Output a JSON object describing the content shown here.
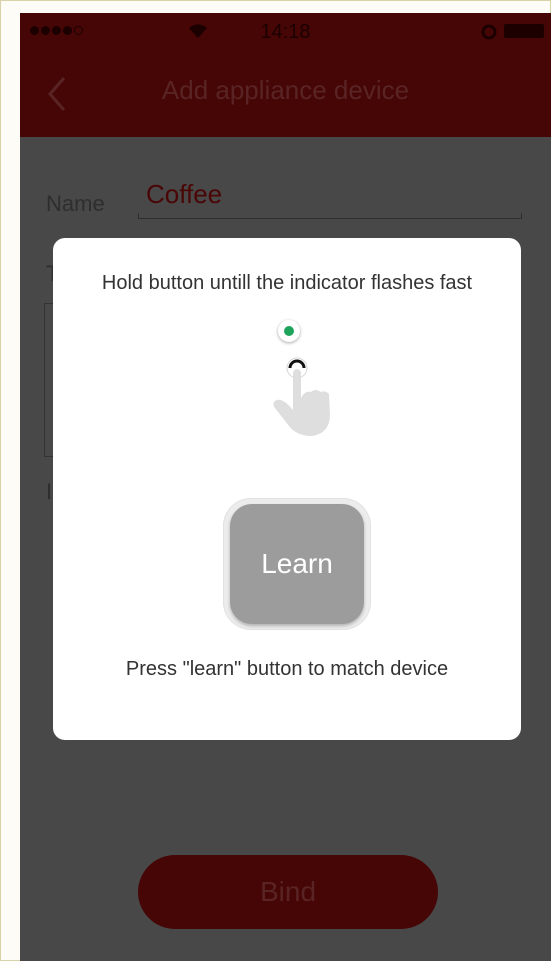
{
  "status_bar": {
    "time": "14:18"
  },
  "nav": {
    "title": "Add appliance device",
    "back_icon": "chevron-left-icon"
  },
  "form": {
    "name_label": "Name",
    "name_value": "Coffee",
    "partial_label_1": "T",
    "partial_label_2": "I"
  },
  "modal": {
    "hint": "Hold button untill the indicator flashes fast",
    "indicator_icon": "indicator-led-icon",
    "pointer_icon": "hand-pointer-icon",
    "learn_label": "Learn",
    "footer": "Press \"learn\" button to match device"
  },
  "bind_button": {
    "label": "Bind"
  },
  "colors": {
    "header_red": "#460606",
    "overlay_gray": "#484848",
    "indicator_green": "#1ea35a",
    "learn_gray": "#9c9c9c"
  }
}
